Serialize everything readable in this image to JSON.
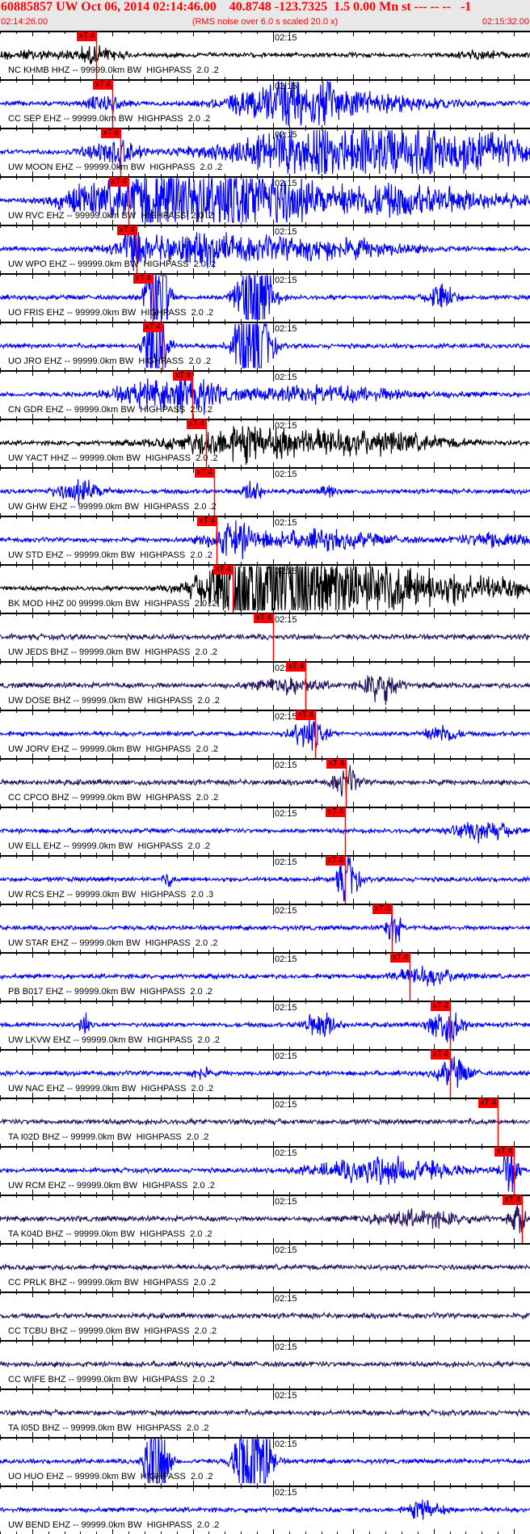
{
  "header": {
    "title": "60885857 UW Oct 06, 2014 02:14:46.00    40.8748 -123.7325  1.5 0.00 Mn st --- -- --   -1",
    "start_time": "02:14:26.00",
    "note": "(RMS noise over 6.0 s scaled 20.0 x)",
    "end_time": "02:15:32.00"
  },
  "chart_data": {
    "type": "line",
    "title": "60885857 UW Oct 06, 2014 02:14:46.00",
    "x_range_seconds": [
      0,
      66
    ],
    "x_start": "02:14:26.00",
    "x_end": "02:15:32.00",
    "minute_mark_label": "02:15",
    "minute_mark_seconds": 34,
    "pick_label": "xT 4",
    "colors": {
      "black": "#000000",
      "blue": "#0000ff",
      "purple": "#2a1660",
      "pick": "#ff0000"
    },
    "traces": [
      {
        "label": "NC KHMB HHZ -- 99999.0km BW  HIGHPASS  2.0 .2",
        "color": "black",
        "pick": 12.0,
        "bursts": [
          [
            12,
            0.25,
            3
          ],
          [
            3,
            0.12,
            6
          ],
          [
            60,
            0.1,
            3
          ]
        ]
      },
      {
        "label": "CC SEP EHZ -- 99999.0km BW  HIGHPASS  2.0 .2",
        "color": "blue",
        "pick": 14.0,
        "bursts": [
          [
            13,
            0.3,
            2
          ],
          [
            36,
            0.9,
            6
          ],
          [
            45,
            0.3,
            10
          ]
        ]
      },
      {
        "label": "UW MOON EHZ -- 99999.0km BW  HIGHPASS  2.0 .2",
        "color": "blue",
        "pick": 15.0,
        "bursts": [
          [
            14,
            0.45,
            3
          ],
          [
            40,
            0.8,
            12
          ],
          [
            56,
            0.65,
            12
          ]
        ]
      },
      {
        "label": "UW RVC EHZ -- 99999.0km BW  HIGHPASS  2.0 .2",
        "color": "blue",
        "pick": 16.0,
        "bursts": [
          [
            11,
            0.5,
            4
          ],
          [
            20,
            1.2,
            5
          ],
          [
            30,
            1.2,
            7
          ],
          [
            48,
            0.55,
            14
          ]
        ]
      },
      {
        "label": "UW WPO EHZ -- 99999.0km BW  HIGHPASS  2.0 .2",
        "color": "blue",
        "pick": 17.0,
        "bursts": [
          [
            16.5,
            1.0,
            1
          ],
          [
            24,
            0.5,
            8
          ],
          [
            40,
            0.35,
            10
          ]
        ]
      },
      {
        "label": "UO FRIS EHZ -- 99999.0km BW  HIGHPASS  2.0 .2",
        "color": "blue",
        "pick": 19.0,
        "bursts": [
          [
            19.7,
            3,
            1.2
          ],
          [
            31.7,
            3,
            1.8
          ],
          [
            55,
            0.6,
            1.5
          ]
        ]
      },
      {
        "label": "UO JRO EHZ -- 99999.0km BW  HIGHPASS  2.0 .2",
        "color": "blue",
        "pick": 20.2,
        "bursts": [
          [
            19.5,
            3,
            1.2
          ],
          [
            31.5,
            3,
            1.8
          ]
        ]
      },
      {
        "label": "CN GDR EHZ -- 99999.0km BW  HIGHPASS  2.0 .2",
        "color": "blue",
        "pick": 23.9,
        "bursts": [
          [
            18,
            0.4,
            4
          ],
          [
            24,
            0.6,
            3
          ],
          [
            40,
            0.25,
            12
          ]
        ]
      },
      {
        "label": "UW YACT HHZ -- 99999.0km BW  HIGHPASS  2.0 .2",
        "color": "black",
        "pick": 25.7,
        "bursts": [
          [
            30,
            0.55,
            8
          ],
          [
            45,
            0.4,
            10
          ]
        ]
      },
      {
        "label": "UW GHW EHZ -- 99999.0km BW  HIGHPASS  2.0 .2",
        "color": "blue",
        "pick": 26.7,
        "bursts": [
          [
            10,
            0.35,
            3
          ],
          [
            31.5,
            0.5,
            1
          ],
          [
            41,
            0.2,
            1
          ]
        ]
      },
      {
        "label": "UW STD EHZ -- 99999.0km BW  HIGHPASS  2.0 .2",
        "color": "blue",
        "pick": 27.0,
        "bursts": [
          [
            29,
            0.6,
            3
          ],
          [
            40,
            0.3,
            8
          ],
          [
            62,
            0.3,
            4
          ]
        ]
      },
      {
        "label": "BK MOD HHZ 00 99999.0km BW  HIGHPASS  2.0 .2",
        "color": "black",
        "pick": 29.0,
        "bursts": [
          [
            33,
            3,
            6
          ],
          [
            45,
            0.9,
            8
          ],
          [
            58,
            0.4,
            10
          ]
        ]
      },
      {
        "label": "UW JEDS BHZ -- 99999.0km BW  HIGHPASS  2.0 .2",
        "color": "purple",
        "pick": 34.0,
        "bursts": []
      },
      {
        "label": "UW DOSE BHZ -- 99999.0km BW  HIGHPASS  2.0 .2",
        "color": "purple",
        "pick": 38.0,
        "bursts": [
          [
            47.5,
            0.6,
            2
          ],
          [
            36,
            0.25,
            4
          ]
        ]
      },
      {
        "label": "UW JORV EHZ -- 99999.0km BW  HIGHPASS  2.0 .2",
        "color": "blue",
        "pick": 39.2,
        "bursts": [
          [
            38.5,
            0.55,
            2
          ],
          [
            55,
            0.3,
            2
          ]
        ]
      },
      {
        "label": "CC CPCO BHZ -- 99999.0km BW  HIGHPASS  2.0 .2",
        "color": "purple",
        "pick": 43.1,
        "bursts": [
          [
            43,
            0.5,
            1.5
          ]
        ]
      },
      {
        "label": "UW ELL EHZ -- 99999.0km BW  HIGHPASS  2.0 .2",
        "color": "blue",
        "pick": 43.0,
        "bursts": [
          [
            60,
            0.3,
            4
          ]
        ]
      },
      {
        "label": "UW RCS EHZ -- 99999.0km BW  HIGHPASS  2.0 .3",
        "color": "blue",
        "pick": 43.0,
        "bursts": [
          [
            43.3,
            1.0,
            1.2
          ],
          [
            21,
            0.3,
            0.5
          ]
        ]
      },
      {
        "label": "UW STAR EHZ -- 99999.0km BW  HIGHPASS  2.0 .2",
        "color": "blue",
        "pick": 48.8,
        "bursts": [
          [
            49,
            0.8,
            0.8
          ]
        ]
      },
      {
        "label": "PB B017 EHZ -- 99999.0km BW  HIGHPASS  2.0 .2",
        "color": "blue",
        "pick": 51.0,
        "bursts": [
          [
            53,
            0.3,
            4
          ]
        ]
      },
      {
        "label": "UW LKVW EHZ -- 99999.0km BW  HIGHPASS  2.0 .2",
        "color": "blue",
        "pick": 56.0,
        "bursts": [
          [
            10.5,
            0.5,
            0.5
          ],
          [
            40,
            0.45,
            2
          ],
          [
            55.5,
            0.65,
            2
          ]
        ]
      },
      {
        "label": "UW NAC EHZ -- 99999.0km BW  HIGHPASS  2.0 .2",
        "color": "blue",
        "pick": 56.0,
        "bursts": [
          [
            56.5,
            0.5,
            2
          ],
          [
            25,
            0.25,
            1
          ]
        ]
      },
      {
        "label": "TA I02D BHZ -- 99999.0km BW  HIGHPASS  2.0 .2",
        "color": "purple",
        "pick": 62.0,
        "bursts": []
      },
      {
        "label": "UW RCM EHZ -- 99999.0km BW  HIGHPASS  2.0 .2",
        "color": "blue",
        "pick": 64.0,
        "bursts": [
          [
            48,
            0.45,
            8
          ],
          [
            63.5,
            0.85,
            1
          ]
        ]
      },
      {
        "label": "TA K04D BHZ -- 99999.0km BW  HIGHPASS  2.0 .2",
        "color": "purple",
        "pick": 65.0,
        "bursts": [
          [
            52,
            0.25,
            6
          ],
          [
            64.5,
            0.45,
            1
          ]
        ]
      },
      {
        "label": "CC PRLK BHZ -- 99999.0km BW  HIGHPASS  2.0 .2",
        "color": "purple",
        "pick": null,
        "bursts": []
      },
      {
        "label": "CC TCBU BHZ -- 99999.0km BW  HIGHPASS  2.0 .2",
        "color": "purple",
        "pick": null,
        "bursts": []
      },
      {
        "label": "CC WIFE BHZ -- 99999.0km BW  HIGHPASS  2.0 .2",
        "color": "purple",
        "pick": null,
        "bursts": []
      },
      {
        "label": "TA I05D BHZ -- 99999.0km BW  HIGHPASS  2.0 .2",
        "color": "purple",
        "pick": null,
        "bursts": []
      },
      {
        "label": "UO HUO EHZ -- 99999.0km BW  HIGHPASS  2.0 .2",
        "color": "blue",
        "pick": null,
        "bursts": [
          [
            19.5,
            3,
            1.2
          ],
          [
            31.5,
            3,
            1.8
          ]
        ]
      },
      {
        "label": "UW BEND EHZ -- 99999.0km BW  HIGHPASS  2.0 .2",
        "color": "blue",
        "pick": null,
        "bursts": [
          [
            53,
            0.35,
            2
          ]
        ]
      }
    ]
  }
}
